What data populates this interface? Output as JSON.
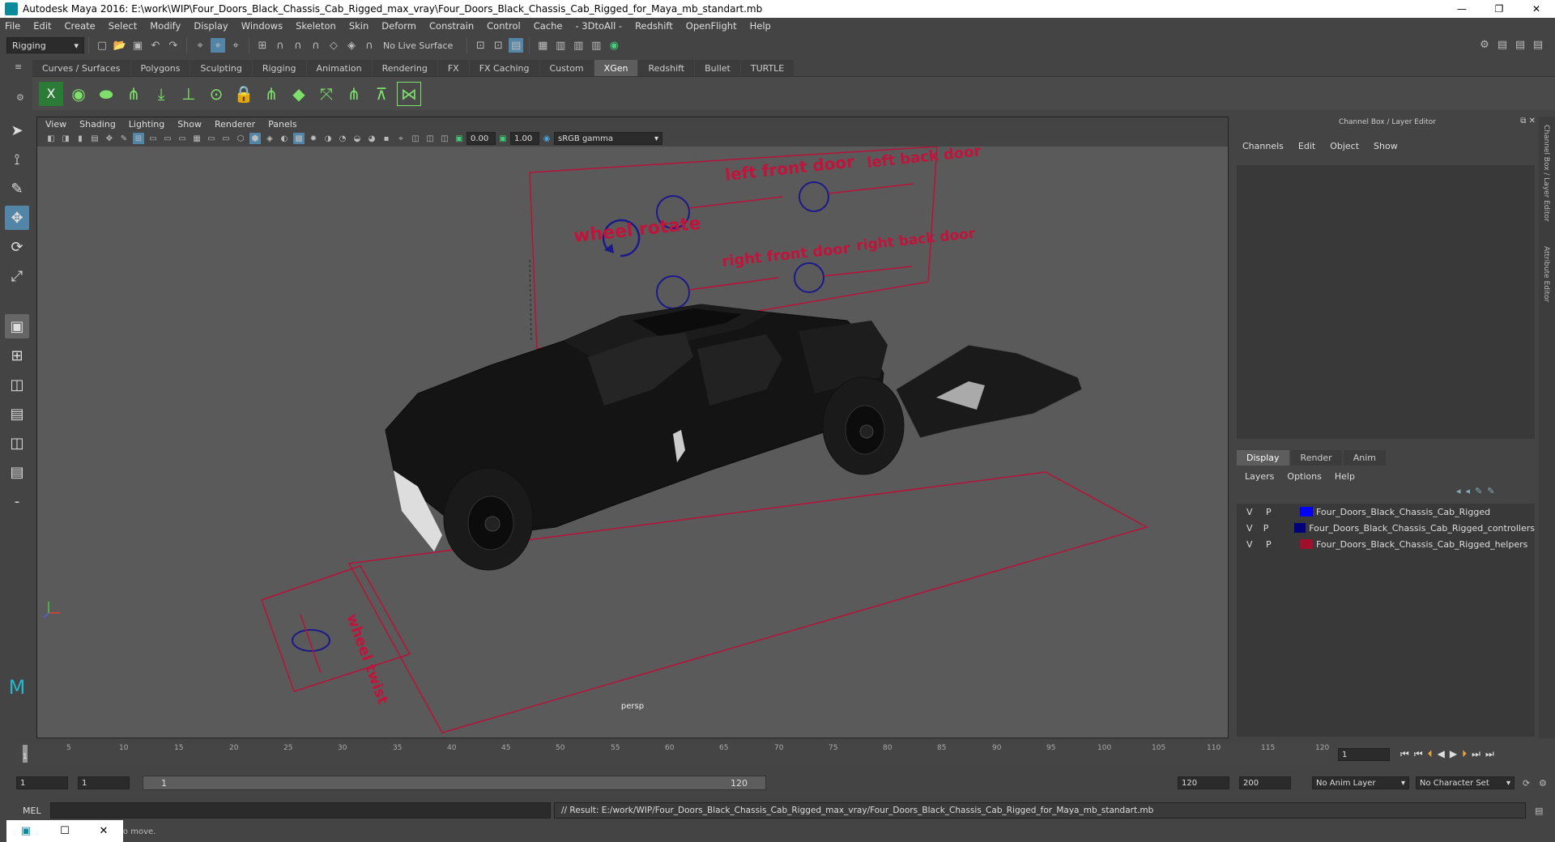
{
  "window": {
    "title": "Autodesk Maya 2016: E:\\work\\WIP\\Four_Doors_Black_Chassis_Cab_Rigged_max_vray\\Four_Doors_Black_Chassis_Cab_Rigged_for_Maya_mb_standart.mb",
    "min": "—",
    "max": "❐",
    "close": "✕"
  },
  "menubar": [
    "File",
    "Edit",
    "Create",
    "Select",
    "Modify",
    "Display",
    "Windows",
    "Skeleton",
    "Skin",
    "Deform",
    "Constrain",
    "Control",
    "Cache",
    "- 3DtoAll -",
    "Redshift",
    "OpenFlight",
    "Help"
  ],
  "statusline": {
    "mode": "Rigging",
    "live_surface": "No Live Surface"
  },
  "shelf": {
    "tabs": [
      "Curves / Surfaces",
      "Polygons",
      "Sculpting",
      "Rigging",
      "Animation",
      "Rendering",
      "FX",
      "FX Caching",
      "Custom",
      "XGen",
      "Redshift",
      "Bullet",
      "TURTLE"
    ],
    "active_tab": "XGen"
  },
  "viewport": {
    "menu": [
      "View",
      "Shading",
      "Lighting",
      "Show",
      "Renderer",
      "Panels"
    ],
    "exposure": "0.00",
    "gamma": "1.00",
    "color_space": "sRGB gamma",
    "camera": "persp",
    "labels": {
      "left_front_door": "left front door",
      "left_back_door": "left back door",
      "wheel_rotate": "wheel rotate",
      "right_front_door": "right front door",
      "right_back_door": "right back door",
      "wheel_twist": "wheel twist"
    }
  },
  "channel_box": {
    "title": "Channel Box / Layer Editor",
    "menu": [
      "Channels",
      "Edit",
      "Object",
      "Show"
    ]
  },
  "layer_editor": {
    "tabs": [
      "Display",
      "Render",
      "Anim"
    ],
    "active_tab": "Display",
    "menu": [
      "Layers",
      "Options",
      "Help"
    ],
    "layers": [
      {
        "v": "V",
        "p": "P",
        "color": "#0000ff",
        "name": "Four_Doors_Black_Chassis_Cab_Rigged"
      },
      {
        "v": "V",
        "p": "P",
        "color": "#00007a",
        "name": "Four_Doors_Black_Chassis_Cab_Rigged_controllers"
      },
      {
        "v": "V",
        "p": "P",
        "color": "#a0102a",
        "name": "Four_Doors_Black_Chassis_Cab_Rigged_helpers"
      }
    ]
  },
  "side_tabs": [
    "Channel Box / Layer Editor",
    "Attribute Editor"
  ],
  "timeline": {
    "labels": [
      "1",
      "5",
      "10",
      "15",
      "20",
      "25",
      "30",
      "35",
      "40",
      "45",
      "50",
      "55",
      "60",
      "65",
      "70",
      "75",
      "80",
      "85",
      "90",
      "95",
      "100",
      "105",
      "110",
      "115",
      "120"
    ],
    "current_frame": "1"
  },
  "range": {
    "start": "1",
    "playback_start": "1",
    "slider_start": "1",
    "slider_end": "120",
    "playback_end": "120",
    "end": "200",
    "anim_layer": "No Anim Layer",
    "character_set": "No Character Set"
  },
  "command": {
    "lang": "MEL",
    "result": "// Result: E:/work/WIP/Four_Doors_Black_Chassis_Cab_Rigged_max_vray/Four_Doors_Black_Chassis_Cab_Rigged_for_Maya_mb_standart.mb"
  },
  "help_line": "to move."
}
